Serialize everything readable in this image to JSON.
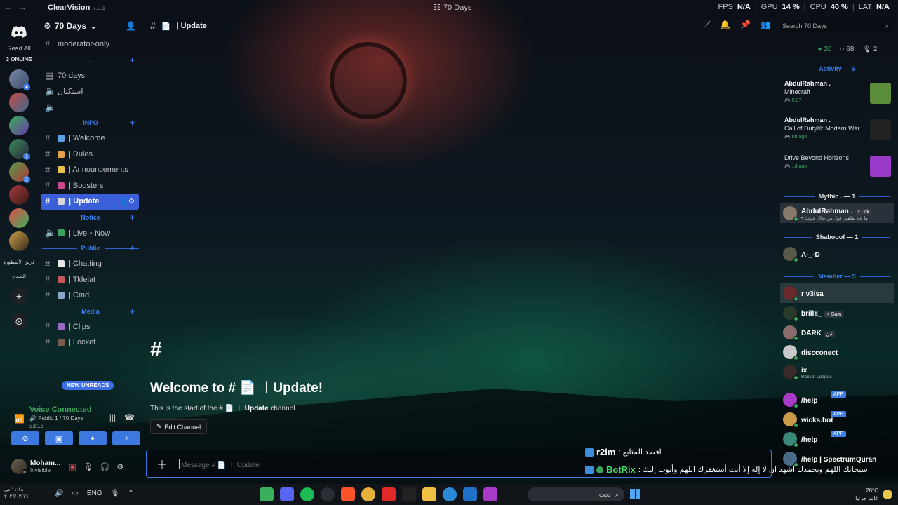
{
  "titlebar": {
    "brand": "ClearVision",
    "version": "7.0.1",
    "server_title": "70 Days",
    "stats": {
      "fps_label": "FPS",
      "fps": "N/A",
      "gpu_label": "GPU",
      "gpu": "14 %",
      "cpu_label": "CPU",
      "cpu": "40 %",
      "lat_label": "LAT",
      "lat": "N/A"
    }
  },
  "rail": {
    "read_all": "Read All",
    "online": "3 ONLINE",
    "text_servers": [
      "فريق الأسطورة",
      "التحدي"
    ]
  },
  "server": {
    "name": "70 Days"
  },
  "channels": {
    "pre": [
      {
        "label": "moderator-only",
        "icon": "hash"
      },
      {
        "label": "70-days",
        "icon": "board"
      },
      {
        "label": "استكنان",
        "icon": "speaker"
      },
      {
        "label": "",
        "icon": "speaker"
      }
    ],
    "sections": [
      {
        "name": "..",
        "items": []
      },
      {
        "name": "INFO",
        "items": [
          {
            "label": "| Welcome",
            "color": "#5aa0e6"
          },
          {
            "label": "| Rules",
            "color": "#e6a04a"
          },
          {
            "label": "| Announcements",
            "color": "#e6c24a"
          },
          {
            "label": "| Boosters",
            "color": "#c84a8c"
          },
          {
            "label": "| Update",
            "color": "#d8d8d8",
            "active": true
          }
        ]
      },
      {
        "name": "Notice",
        "items": [
          {
            "label": "| Live・Now",
            "color": "#3ba55d",
            "speaker": true
          }
        ]
      },
      {
        "name": "Public",
        "items": [
          {
            "label": "| Chatting",
            "color": "#e8e8e8"
          },
          {
            "label": "| Tklejat",
            "color": "#c45a5a"
          },
          {
            "label": "| Cmd",
            "color": "#8aa6c8"
          }
        ]
      },
      {
        "name": "Media",
        "items": [
          {
            "label": "| Clips",
            "color": "#9a6ac8"
          },
          {
            "label": "| Locket",
            "color": "#7a5a4a"
          }
        ]
      }
    ],
    "new_unreads": "NEW UNREADS"
  },
  "voice": {
    "status": "Voice Connected",
    "location": "Public 1 / 70 Days",
    "time": "33:13"
  },
  "user": {
    "name": "Moham...",
    "status": "Invisible"
  },
  "chat": {
    "channel_title": "| Update",
    "search_placeholder": "Search 70 Days",
    "welcome_hash": "#",
    "welcome_title": "Welcome to # 📄 ︱Update!",
    "welcome_sub_prefix": "This is the start of the # 📄 ︱",
    "welcome_sub_channel": "Update",
    "welcome_sub_suffix": "channel.",
    "edit_channel": "Edit Channel",
    "composer_placeholder": "Message # 📄 ︱ Update"
  },
  "overlay": {
    "line1_name": "r2im",
    "line1_text": ": اقصد المتابع",
    "line2_name": "BotRix",
    "line2_text": ": سبحانك اللهم وبحمدك أشهد ان لا إله إلا أنت أستغفرك اللهم وأتوب إليك"
  },
  "members": {
    "counts": {
      "online": "20",
      "idle": "68",
      "other": "2"
    },
    "activity_header": "Activity — 6",
    "activities": [
      {
        "name": "AbdulRahman .",
        "game": "Minecraft",
        "time": "5:37",
        "color": "#5b8c3a"
      },
      {
        "name": "AbdulRahman .",
        "game": "Call of Duty®: Modern War...",
        "time": "8h ago",
        "color": "#222222"
      },
      {
        "name": "",
        "game": "Drive Beyond Horizons",
        "time": "1d ago",
        "color": "#9a3ac8"
      }
    ],
    "mythic_header": "Mythic . — 1",
    "mythic": [
      {
        "name": "AbdulRahman .",
        "tag": "⚡Tick",
        "sub": "• ما عاد يقلقني قول من بدال عيونك"
      }
    ],
    "shabooof_header": "Shabooof — 1",
    "shabooof": [
      {
        "name": "A-_-D"
      }
    ],
    "member_header": "Member — 5",
    "member": [
      {
        "name": "r v3isa",
        "tag": "",
        "sub": ""
      },
      {
        "name": "brill8_",
        "tag": "⚡ Sam",
        "sub": ""
      },
      {
        "name": "DARK",
        "tag": "تين",
        "sub": ""
      },
      {
        "name": "discconect",
        "tag": "",
        "sub": ""
      },
      {
        "name": "ix",
        "tag": "",
        "sub": "Rocket League"
      }
    ],
    "bots": [
      {
        "name": "/help",
        "badge": "APP"
      },
      {
        "name": "wicks.bot",
        "badge": "APP"
      },
      {
        "name": "/help",
        "badge": "APP"
      },
      {
        "name": "/help | SpectrumQuran",
        "badge": ""
      }
    ]
  },
  "taskbar": {
    "time": "١١:١٨ ص",
    "date": "٢٠٢٦/٠٣/١٦",
    "lang": "ENG",
    "search_label": "بحث",
    "temp": "28°C",
    "weather": "غائم جزئيا"
  }
}
